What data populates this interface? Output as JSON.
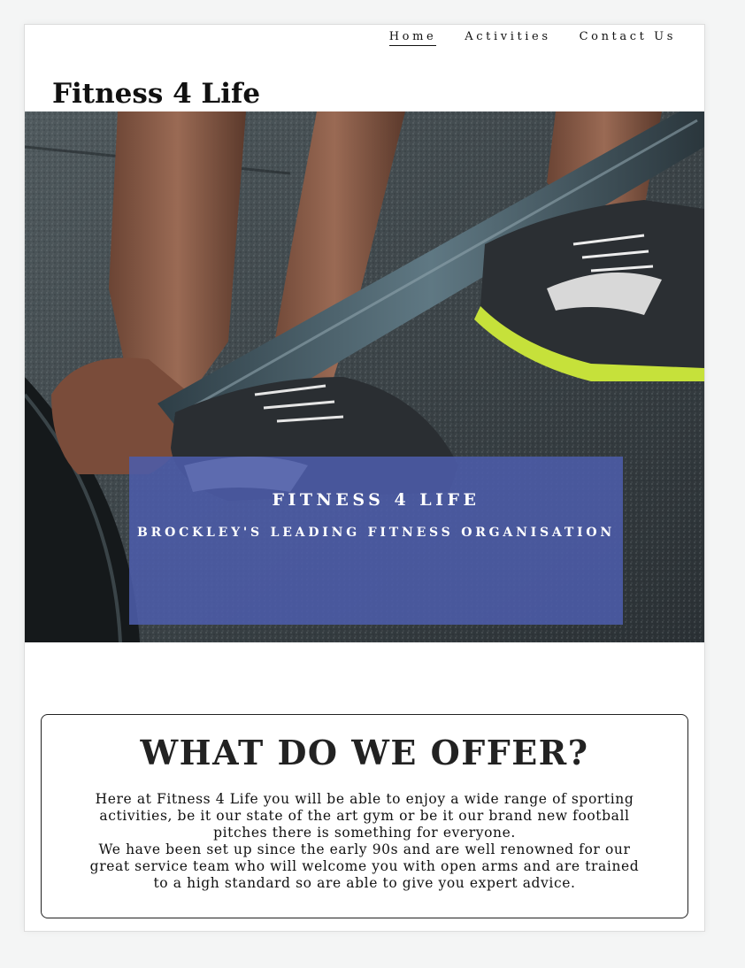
{
  "nav": {
    "items": [
      {
        "label": "Home",
        "active": true
      },
      {
        "label": "Activities",
        "active": false
      },
      {
        "label": "Contact Us",
        "active": false
      }
    ]
  },
  "brand": {
    "title": "Fitness 4 Life"
  },
  "hero": {
    "banner_title": "FITNESS 4 LIFE",
    "banner_subtitle": "BROCKLEY'S LEADING FITNESS ORGANISATION",
    "banner_color": "#4c5caa"
  },
  "offer": {
    "heading": "WHAT DO WE OFFER?",
    "paragraph_1": "Here at Fitness 4 Life you will be able to enjoy a wide range of sporting activities, be it our state of the art gym or be it our brand new football pitches there is something for everyone.",
    "paragraph_2": "We have been set up since the early 90s and are well renowned for our great service team who will welcome you with open arms and are trained to a high standard so are able to give you expert advice."
  }
}
